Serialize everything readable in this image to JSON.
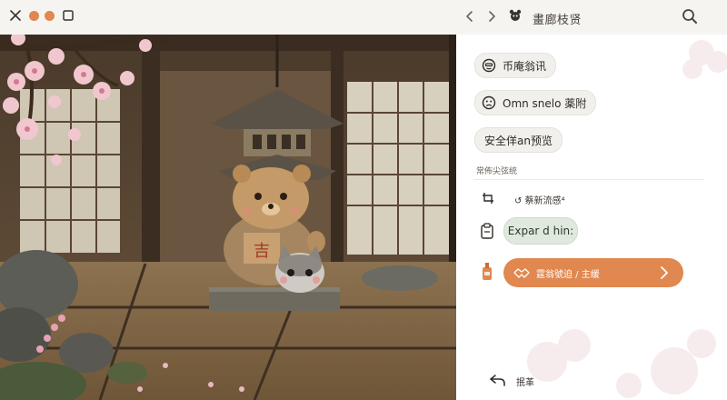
{
  "window": {
    "title": "畫廊枝贤",
    "accent": "#e0884f",
    "traffic_colors": [
      "#e0884f",
      "#e0884f"
    ]
  },
  "toolbar": {
    "close_icon": "close-icon",
    "maximize_icon": "square-icon",
    "back_icon": "arrow-left-icon",
    "forward_icon": "arrow-right-icon",
    "app_icon": "mascot-icon",
    "search_icon": "search-icon"
  },
  "panel": {
    "chips": [
      {
        "label": "币庵翁讯",
        "icon": "face-icon"
      },
      {
        "label": "Omn snelo 薬附",
        "icon": "sad-face-icon"
      },
      {
        "label": "安全佯an预览",
        "icon": ""
      }
    ],
    "section_label": "常佈尖弦统",
    "tool_row_text": "↺ 蔡新流感⁴",
    "expand_label": "Expar d hin:",
    "cta_label": "霆翁號迫 / 主缓",
    "bottom_label": "抿革"
  }
}
